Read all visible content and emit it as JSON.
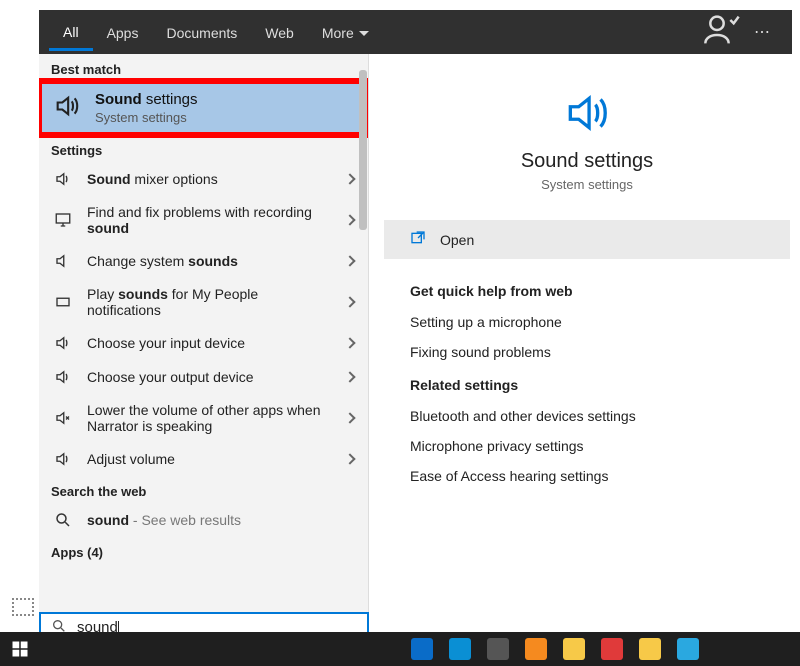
{
  "topbar": {
    "tabs": [
      "All",
      "Apps",
      "Documents",
      "Web",
      "More"
    ],
    "active": 0
  },
  "sections": {
    "best_match": "Best match",
    "settings": "Settings",
    "search_web": "Search the web",
    "apps": "Apps (4)"
  },
  "best": {
    "title_bold": "Sound",
    "title_rest": " settings",
    "subtitle": "System settings"
  },
  "rows": [
    {
      "bold": "Sound",
      "rest": " mixer options",
      "icon": "speaker"
    },
    {
      "pre": "Find and fix problems with recording ",
      "bold": "sound",
      "icon": "monitor",
      "multi": true
    },
    {
      "pre": "Change system ",
      "bold": "sounds",
      "icon": "mute"
    },
    {
      "pre": "Play ",
      "bold": "sounds",
      "rest": " for My People notifications",
      "icon": "rect",
      "multi": true
    },
    {
      "pre": "Choose your input device",
      "icon": "speaker"
    },
    {
      "pre": "Choose your output device",
      "icon": "speaker"
    },
    {
      "pre": "Lower the volume of other apps when Narrator is speaking",
      "icon": "lower",
      "multi": true
    },
    {
      "pre": "Adjust volume",
      "icon": "speaker"
    }
  ],
  "webrow": {
    "bold": "sound",
    "suffix": " - See web results"
  },
  "search": {
    "value": "sound"
  },
  "preview": {
    "title": "Sound settings",
    "subtitle": "System settings",
    "open": "Open",
    "help_hdr": "Get quick help from web",
    "help_links": [
      "Setting up a microphone",
      "Fixing sound problems"
    ],
    "related_hdr": "Related settings",
    "related_links": [
      "Bluetooth and other devices settings",
      "Microphone privacy settings",
      "Ease of Access hearing settings"
    ]
  },
  "taskbar_colors": [
    "#0a6cc8",
    "#0a8fd4",
    "#555",
    "#f58a1f",
    "#f7c948",
    "#e03a3a",
    "#f7c948",
    "#2aa8e0"
  ]
}
